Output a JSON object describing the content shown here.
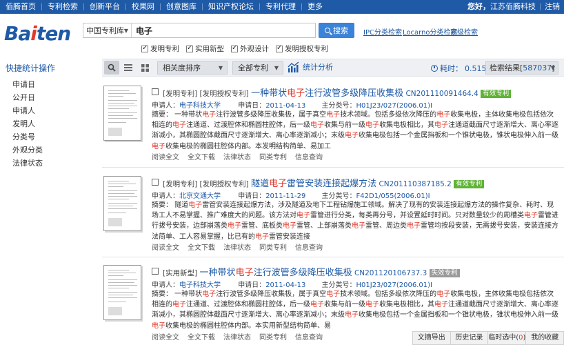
{
  "topnav": {
    "items": [
      "佰腾首页",
      "专利检索",
      "创新平台",
      "校果网",
      "创意图库",
      "知识产权论坛",
      "专利代理",
      "更多"
    ],
    "greeting": "您好，",
    "user": "江苏佰腾科技",
    "logout": "注销"
  },
  "logo": {
    "text_a": "Ba",
    "text_dot": "i",
    "text_b": "ten"
  },
  "search": {
    "db": "中国专利库",
    "query": "电子",
    "button": "搜索",
    "links": [
      "IPC分类检索",
      "Locarno分类检索",
      "高级检索"
    ],
    "types": [
      {
        "label": "发明专利",
        "checked": true
      },
      {
        "label": "实用新型",
        "checked": true
      },
      {
        "label": "外观设计",
        "checked": true
      },
      {
        "label": "发明授权专利",
        "checked": true
      }
    ]
  },
  "sidebar": {
    "title": "快捷统计操作",
    "items": [
      "申请日",
      "公开日",
      "申请人",
      "发明人",
      "分类号",
      "外观分类",
      "法律状态"
    ]
  },
  "toolbar": {
    "sort": "相关度排序",
    "filter": "全部专利",
    "analysis": "统计分析",
    "time_label": "耗时：",
    "time_value": "0.515s",
    "results_label": "检索结果[",
    "results_count": "587037",
    "results_end": "]"
  },
  "records": [
    {
      "type": "[发明专利] [发明授权专利]",
      "title_a": "一种带状",
      "title_hl": "电子",
      "title_b": "注行波管多级降压收集极",
      "pno": "CN201110091464.4",
      "status": "有效专利",
      "status_color": "#5fb336",
      "applicant_label": "申请人：",
      "applicant": "电子科技大学",
      "date_label": "申请日：",
      "date": "2011-04-13",
      "ipc_label": "主分类号：",
      "ipc": "H01J23/027(2006.01)I",
      "abstract_segments": [
        {
          "t": "摘要： 一种带状"
        },
        {
          "t": "电子",
          "hl": true
        },
        {
          "t": "注行波管多级降压收集极，属于真空"
        },
        {
          "t": "电子",
          "hl": true
        },
        {
          "t": "技术领域。包括多级依次降压的"
        },
        {
          "t": "电子",
          "hl": true
        },
        {
          "t": "收集电极，主体收集电极包括依次相连的"
        },
        {
          "t": "电子",
          "hl": true
        },
        {
          "t": "注通道、过渡腔体和椭圆柱腔体，后一级"
        },
        {
          "t": "电子",
          "hl": true
        },
        {
          "t": "收集与前一级"
        },
        {
          "t": "电子",
          "hl": true
        },
        {
          "t": "收集电极相比，其"
        },
        {
          "t": "电子",
          "hl": true
        },
        {
          "t": "注通道截面尺寸逐渐增大、离心率逐渐减小，其椭圆腔体截面尺寸逐渐增大、离心率逐渐减小；末级"
        },
        {
          "t": "电子",
          "hl": true
        },
        {
          "t": "收集电极包括一个金属挡板和一个锥状电极，锥状电极伸入前一级"
        },
        {
          "t": "电子",
          "hl": true
        },
        {
          "t": "收集电极的椭圆柱腔体内部。本发明结构简单、易加工"
        }
      ],
      "links": [
        "阅读全文",
        "全文下载",
        "法律状态",
        "同类专利",
        "信息查询"
      ]
    },
    {
      "type": "[发明专利] [发明授权专利]",
      "title_a": "隧道",
      "title_hl": "电子",
      "title_b": "雷管安装连接起爆方法",
      "pno": "CN201110387185.2",
      "status": "有效专利",
      "status_color": "#5fb336",
      "applicant_label": "申请人：",
      "applicant": "北京交通大学",
      "date_label": "申请日：",
      "date": "2011-11-29",
      "ipc_label": "主分类号：",
      "ipc": "F42D1/055(2006.01)I",
      "abstract_segments": [
        {
          "t": "摘要： 隧道"
        },
        {
          "t": "电子",
          "hl": true
        },
        {
          "t": "雷管安装连接起爆方法，涉及隧道及地下工程钻爆施工领域。解决了现有的安装连接起爆方法的操作复杂、耗时、现场工人不易掌握、推广难度大的问题。该方法对"
        },
        {
          "t": "电子",
          "hl": true
        },
        {
          "t": "雷管进行分类，每类再分号，并设置延时时间。只对数量较少的周槽类"
        },
        {
          "t": "电子",
          "hl": true
        },
        {
          "t": "雷管进行拔号安装，边部崩落类"
        },
        {
          "t": "电子",
          "hl": true
        },
        {
          "t": "雷管、底板类"
        },
        {
          "t": "电子",
          "hl": true
        },
        {
          "t": "雷管、上部崩落类"
        },
        {
          "t": "电子",
          "hl": true
        },
        {
          "t": "雷管、周边类"
        },
        {
          "t": "电子",
          "hl": true
        },
        {
          "t": "雷管均按段安装，无需拔号安装，安装连接方法简单、工人容易掌握，比已有的"
        },
        {
          "t": "电子",
          "hl": true
        },
        {
          "t": "雷管安装连接"
        }
      ],
      "links": [
        "阅读全文",
        "全文下载",
        "法律状态",
        "同类专利",
        "信息查询"
      ]
    },
    {
      "type": "[实用新型]",
      "title_a": "一种带状",
      "title_hl": "电子",
      "title_b": "注行波管多级降压收集极",
      "pno": "CN201120106737.3",
      "status": "失效专利",
      "status_color": "#9a9a9a",
      "applicant_label": "申请人：",
      "applicant": "电子科技大学",
      "date_label": "申请日：",
      "date": "2011-04-13",
      "ipc_label": "主分类号：",
      "ipc": "H01J23/027(2006.01)I",
      "abstract_segments": [
        {
          "t": "摘要： 一种带状"
        },
        {
          "t": "电子",
          "hl": true
        },
        {
          "t": "注行波管多级降压收集极，属于真空"
        },
        {
          "t": "电子",
          "hl": true
        },
        {
          "t": "技术领域。包括多级依次降压的"
        },
        {
          "t": "电子",
          "hl": true
        },
        {
          "t": "收集电极，主体收集电极包括依次相连的"
        },
        {
          "t": "电子",
          "hl": true
        },
        {
          "t": "注通道、过渡腔体和椭圆柱腔体，后一级"
        },
        {
          "t": "电子",
          "hl": true
        },
        {
          "t": "收集与前一级"
        },
        {
          "t": "电子",
          "hl": true
        },
        {
          "t": "收集电极相比，其"
        },
        {
          "t": "电子",
          "hl": true
        },
        {
          "t": "注通道截面尺寸逐渐增大、离心率逐渐减小，其椭圆腔体截面尺寸逐渐增大、离心率逐渐减小；末级"
        },
        {
          "t": "电子",
          "hl": true
        },
        {
          "t": "收集电极包括一个金属挡板和一个锥状电极，锥状电极伸入前一级"
        },
        {
          "t": "电子",
          "hl": true
        },
        {
          "t": "收集电极的椭圆柱腔体内部。本实用新型结构简单、易"
        }
      ],
      "links": [
        "阅读全文",
        "全文下载",
        "法律状态",
        "同类专利",
        "信息查询"
      ]
    }
  ],
  "bottombar": {
    "export": "文摘导出",
    "history": "历史记录",
    "temp_label": "临时选中(",
    "temp_count": "0",
    "temp_end": ")",
    "favorites": "我的收藏"
  }
}
